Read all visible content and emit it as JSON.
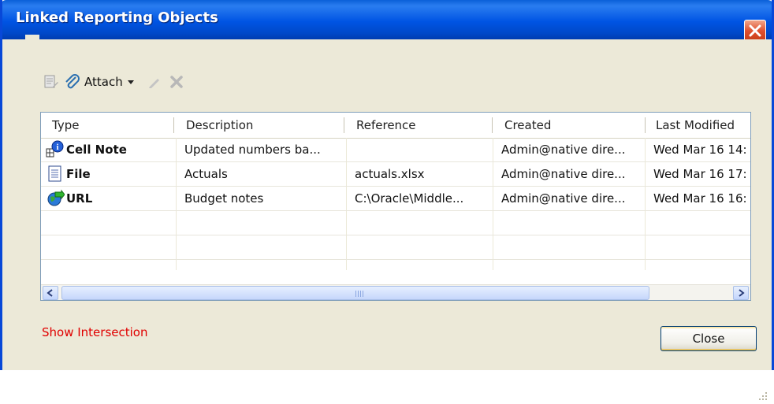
{
  "window": {
    "title": "Linked Reporting Objects"
  },
  "toolbar": {
    "attach_label": "Attach"
  },
  "grid": {
    "columns": [
      "Type",
      "Description",
      "Reference",
      "Created",
      "Last Modified"
    ],
    "rows": [
      {
        "type": "Cell Note",
        "icon": "cell-note-icon",
        "description": "Updated numbers ba...",
        "reference": "",
        "created": "Admin@native dire...",
        "modified": "Wed Mar 16 14:"
      },
      {
        "type": "File",
        "icon": "file-icon",
        "description": "Actuals",
        "reference": "actuals.xlsx",
        "created": "Admin@native dire...",
        "modified": "Wed Mar 16 17:"
      },
      {
        "type": "URL",
        "icon": "url-icon",
        "description": "Budget notes",
        "reference": "C:\\Oracle\\Middle...",
        "created": "Admin@native dire...",
        "modified": "Wed Mar 16 16:"
      }
    ]
  },
  "footer": {
    "show_intersection": "Show Intersection",
    "close_label": "Close"
  },
  "colors": {
    "titlebar": "#0054e3",
    "dialog_bg": "#ece9d8",
    "link": "#e00000"
  }
}
